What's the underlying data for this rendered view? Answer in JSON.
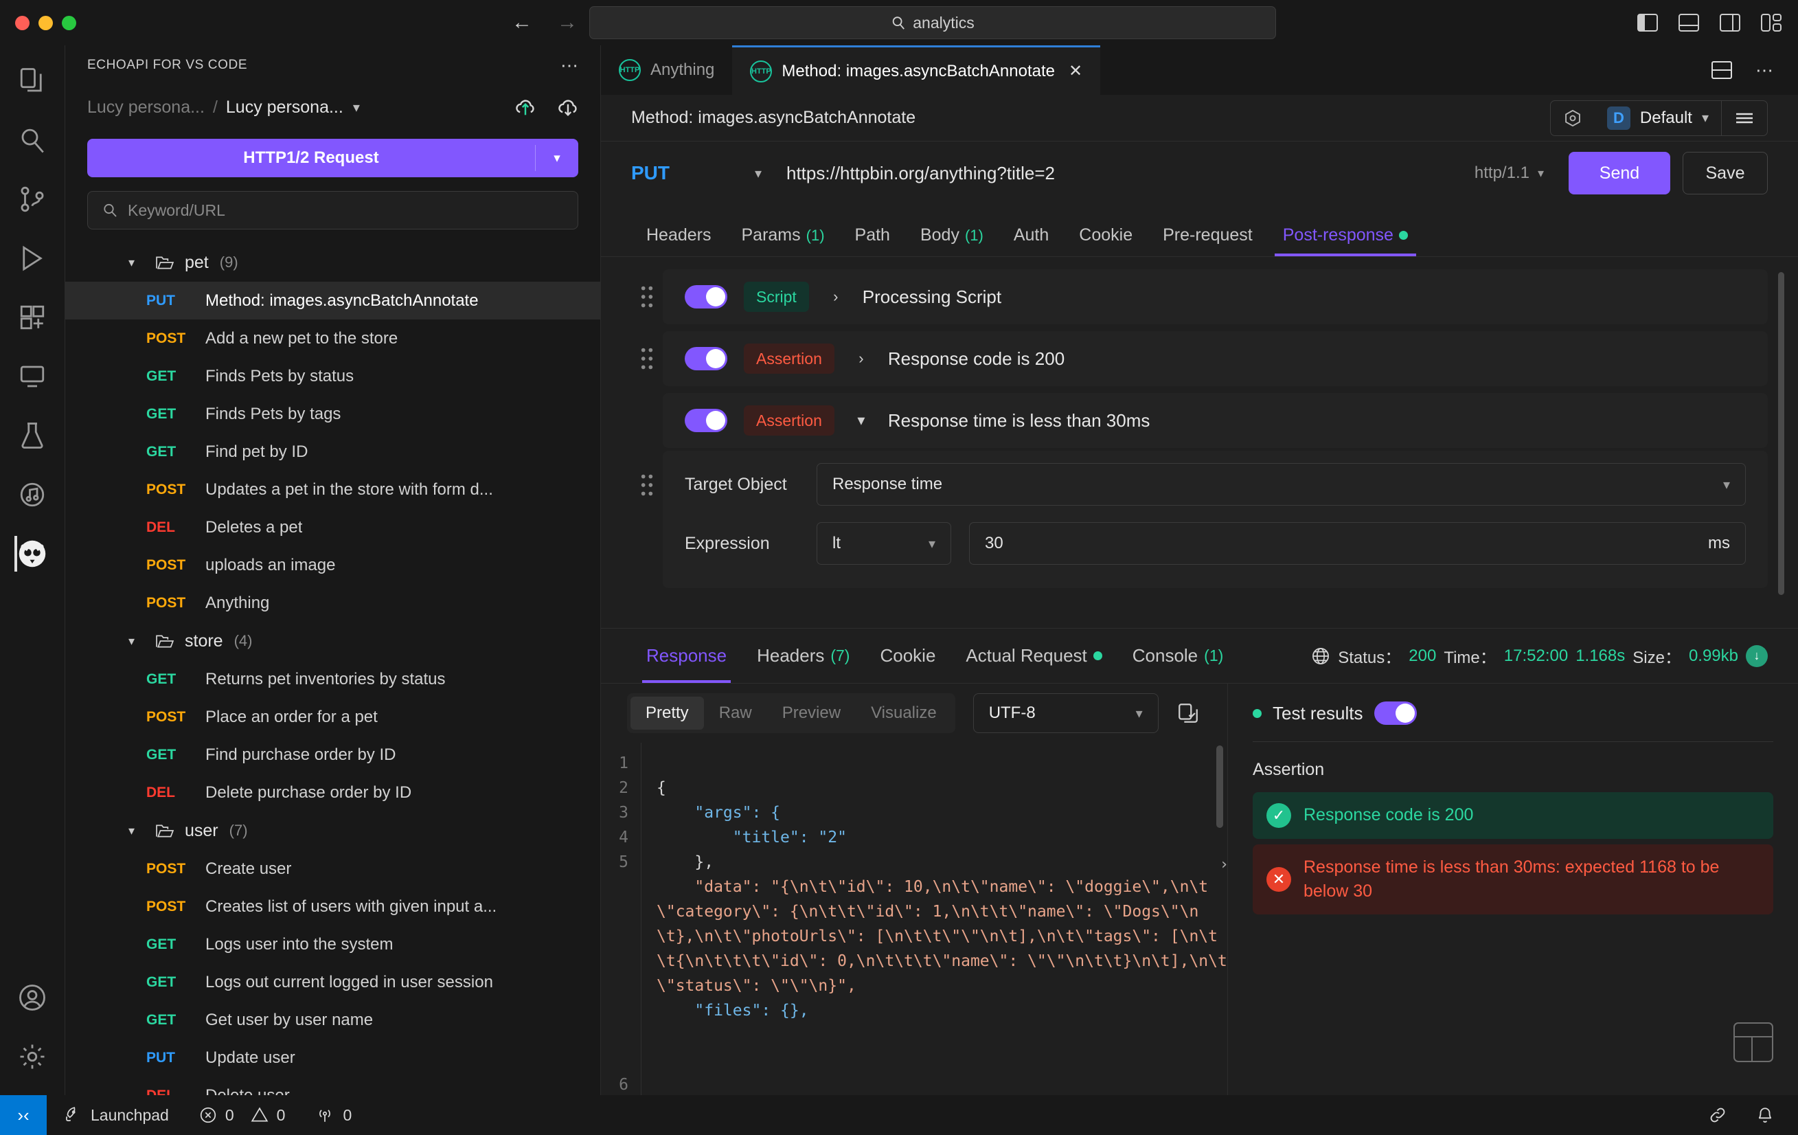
{
  "titlebar": {
    "search_value": "analytics",
    "nav_back_icon": "arrow-left-icon",
    "nav_forward_icon": "arrow-right-icon"
  },
  "activity_bar": {
    "items": [
      {
        "icon": "explorer-icon",
        "name": "explorer"
      },
      {
        "icon": "search-icon",
        "name": "search"
      },
      {
        "icon": "source-control-icon",
        "name": "source-control"
      },
      {
        "icon": "run-debug-icon",
        "name": "run-and-debug"
      },
      {
        "icon": "extensions-icon",
        "name": "extensions"
      },
      {
        "icon": "remote-explorer-icon",
        "name": "remote-explorer"
      },
      {
        "icon": "testing-icon",
        "name": "testing"
      },
      {
        "icon": "music-icon",
        "name": "media"
      },
      {
        "icon": "echoapi-owl-icon",
        "name": "echoapi"
      }
    ],
    "bottom": [
      {
        "icon": "account-icon",
        "name": "accounts"
      },
      {
        "icon": "gear-icon",
        "name": "manage-settings"
      }
    ]
  },
  "sidebar": {
    "title": "ECHOAPI FOR VS CODE",
    "more_icon": "ellipsis-icon",
    "breadcrumb": {
      "parent": "Lucy persona...",
      "separator": "/",
      "current": "Lucy persona...",
      "chevron": "chevron-down-icon",
      "upload_icon": "cloud-upload-icon",
      "download_icon": "cloud-download-icon"
    },
    "request_button": {
      "label": "HTTP1/2 Request",
      "chevron": "chevron-down-icon"
    },
    "search": {
      "placeholder": "Keyword/URL",
      "icon": "search-icon"
    },
    "folders": [
      {
        "name": "pet",
        "count": "(9)",
        "items": [
          {
            "method": "PUT",
            "name": "Method: images.asyncBatchAnnotate",
            "selected": true
          },
          {
            "method": "POST",
            "name": "Add a new pet to the store",
            "selected": false
          },
          {
            "method": "GET",
            "name": "Finds Pets by status",
            "selected": false
          },
          {
            "method": "GET",
            "name": "Finds Pets by tags",
            "selected": false
          },
          {
            "method": "GET",
            "name": "Find pet by ID",
            "selected": false
          },
          {
            "method": "POST",
            "name": "Updates a pet in the store with form d...",
            "selected": false
          },
          {
            "method": "DEL",
            "name": "Deletes a pet",
            "selected": false
          },
          {
            "method": "POST",
            "name": "uploads an image",
            "selected": false
          },
          {
            "method": "POST",
            "name": "Anything",
            "selected": false
          }
        ]
      },
      {
        "name": "store",
        "count": "(4)",
        "items": [
          {
            "method": "GET",
            "name": "Returns pet inventories by status",
            "selected": false
          },
          {
            "method": "POST",
            "name": "Place an order for a pet",
            "selected": false
          },
          {
            "method": "GET",
            "name": "Find purchase order by ID",
            "selected": false
          },
          {
            "method": "DEL",
            "name": "Delete purchase order by ID",
            "selected": false
          }
        ]
      },
      {
        "name": "user",
        "count": "(7)",
        "items": [
          {
            "method": "POST",
            "name": "Create user",
            "selected": false
          },
          {
            "method": "POST",
            "name": "Creates list of users with given input a...",
            "selected": false
          },
          {
            "method": "GET",
            "name": "Logs user into the system",
            "selected": false
          },
          {
            "method": "GET",
            "name": "Logs out current logged in user session",
            "selected": false
          },
          {
            "method": "GET",
            "name": "Get user by user name",
            "selected": false
          },
          {
            "method": "PUT",
            "name": "Update user",
            "selected": false
          },
          {
            "method": "DEL",
            "name": "Delete user",
            "selected": false
          }
        ]
      }
    ]
  },
  "editor": {
    "tabs": [
      {
        "label": "Anything",
        "icon": "http-icon",
        "active": false,
        "closable": false
      },
      {
        "label": "Method: images.asyncBatchAnnotate",
        "icon": "http-icon",
        "active": true,
        "closable": true,
        "close_icon": "close-icon"
      }
    ],
    "tabbar_actions": [
      {
        "icon": "split-editor-icon",
        "name": "split-editor"
      },
      {
        "icon": "ellipsis-icon",
        "name": "more-actions"
      }
    ],
    "request_title": "Method: images.asyncBatchAnnotate",
    "environment": {
      "settings_icon": "env-settings-icon",
      "badge": "D",
      "name": "Default",
      "chevron": "chevron-down-icon",
      "menu_icon": "hamburger-icon"
    },
    "url_row": {
      "method": "PUT",
      "method_chevron": "chevron-down-icon",
      "url": "https://httpbin.org/anything?title=2",
      "protocol": "http/1.1",
      "protocol_chevron": "chevron-down-icon",
      "send_label": "Send",
      "save_label": "Save"
    },
    "subtabs": [
      {
        "label": "Headers",
        "count": "",
        "active": false,
        "dot": false
      },
      {
        "label": "Params",
        "count": "(1)",
        "active": false,
        "dot": false
      },
      {
        "label": "Path",
        "count": "",
        "active": false,
        "dot": false
      },
      {
        "label": "Body",
        "count": "(1)",
        "active": false,
        "dot": false
      },
      {
        "label": "Auth",
        "count": "",
        "active": false,
        "dot": false
      },
      {
        "label": "Cookie",
        "count": "",
        "active": false,
        "dot": false
      },
      {
        "label": "Pre-request",
        "count": "",
        "active": false,
        "dot": false
      },
      {
        "label": "Post-response",
        "count": "",
        "active": true,
        "dot": true
      }
    ]
  },
  "post_response": {
    "rows": [
      {
        "type": "Script",
        "kind": "script",
        "caret": "chevron-right-icon",
        "title": "Processing Script",
        "enabled": true
      },
      {
        "type": "Assertion",
        "kind": "assertion",
        "caret": "chevron-right-icon",
        "title": "Response code is 200",
        "enabled": true
      },
      {
        "type": "Assertion",
        "kind": "assertion",
        "caret": "chevron-down-icon",
        "title": "Response time is less than 30ms",
        "enabled": true
      }
    ],
    "detail": {
      "target_object_label": "Target Object",
      "target_object_value": "Response time",
      "expression_label": "Expression",
      "operator_value": "lt",
      "threshold_value": "30",
      "unit": "ms"
    }
  },
  "response": {
    "tabs": [
      {
        "label": "Response",
        "count": "",
        "active": true,
        "dot": false
      },
      {
        "label": "Headers",
        "count": "(7)",
        "active": false,
        "dot": false
      },
      {
        "label": "Cookie",
        "count": "",
        "active": false,
        "dot": false
      },
      {
        "label": "Actual Request",
        "count": "",
        "active": false,
        "dot": true
      },
      {
        "label": "Console",
        "count": "(1)",
        "active": false,
        "dot": false
      }
    ],
    "status": {
      "globe_icon": "globe-icon",
      "status_label": "Status：",
      "status_value": "200",
      "time_label": "Time：",
      "time_clock": "17:52:00",
      "time_duration": "1.168s",
      "size_label": "Size：",
      "size_value": "0.99kb",
      "download_icon": "download-icon"
    },
    "format": {
      "segments": [
        {
          "label": "Pretty",
          "active": true
        },
        {
          "label": "Raw",
          "active": false
        },
        {
          "label": "Preview",
          "active": false
        },
        {
          "label": "Visualize",
          "active": false
        }
      ],
      "encoding": "UTF-8",
      "encoding_chevron": "chevron-down-icon",
      "copy_icon": "copy-icon"
    },
    "code": {
      "line_numbers": [
        "1",
        "2",
        "3",
        "4",
        "5",
        "6"
      ],
      "lines": [
        "{",
        "    \"args\": {",
        "        \"title\": \"2\"",
        "    },",
        "    \"data\": \"{\\n\\t\\\"id\\\": 10,\\n\\t\\\"name\\\": \\\"doggie\\\",\\n\\t\\\"category\\\": {\\n\\t\\t\\\"id\\\": 1,\\n\\t\\t\\\"name\\\": \\\"Dogs\\\"\\n\\t},\\n\\t\\\"photoUrls\\\": [\\n\\t\\t\\\"\\\"\\n\\t],\\n\\t\\\"tags\\\": [\\n\\t\\t{\\n\\t\\t\\t\\\"id\\\": 0,\\n\\t\\t\\t\\\"name\\\": \\\"\\\"\\n\\t\\t}\\n\\t],\\n\\t\\\"status\\\": \\\"\\\"\\n}\",",
        "    \"files\": {},"
      ],
      "expand_icon": "chevron-right-icon"
    },
    "test_results": {
      "dot": "status-dot",
      "title": "Test results",
      "toggle_on": true,
      "section_title": "Assertion",
      "items": [
        {
          "status": "pass",
          "icon": "check-circle-icon",
          "text": "Response code is 200"
        },
        {
          "status": "fail",
          "icon": "error-circle-icon",
          "text": "Response time is less than 30ms: expected 1168 to be below 30"
        }
      ],
      "grid_icon": "table-layout-icon"
    }
  },
  "statusbar": {
    "remote_icon": "remote-window-icon",
    "launchpad_icon": "rocket-icon",
    "launchpad_label": "Launchpad",
    "errors_icon": "error-icon",
    "errors_count": "0",
    "warnings_icon": "warning-icon",
    "warnings_count": "0",
    "ports_icon": "radio-tower-icon",
    "ports_count": "0",
    "right_icons": [
      {
        "icon": "link-icon",
        "name": "live-share"
      },
      {
        "icon": "bell-icon",
        "name": "notifications"
      }
    ]
  },
  "colors": {
    "accent": "#8257fe",
    "get": "#2bd7a0",
    "post": "#ffa90a",
    "put": "#2f9bff",
    "del": "#ff3b30",
    "pass": "#2bd7a0",
    "fail": "#ff5b42"
  }
}
